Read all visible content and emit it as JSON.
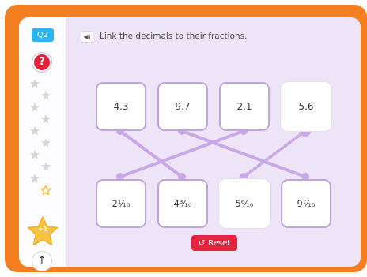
{
  "question": {
    "badge": "Q2",
    "instruction": "Link the decimals to their fractions."
  },
  "sidebar": {
    "help_label": "?",
    "stars_total": 10,
    "stars_earned": 1,
    "star_reward": "+1",
    "scroll_label": "↑"
  },
  "decimals": [
    "4.3",
    "9.7",
    "2.1",
    "5.6"
  ],
  "fractions": [
    "2¹⁄₁₀",
    "4³⁄₁₀",
    "5⁶⁄₁₀",
    "9⁷⁄₁₀"
  ],
  "links": [
    {
      "decimal": "4.3",
      "fraction": "4³⁄₁₀",
      "status": "linked"
    },
    {
      "decimal": "9.7",
      "fraction": "9⁷⁄₁₀",
      "status": "linked"
    },
    {
      "decimal": "2.1",
      "fraction": "2¹⁄₁₀",
      "status": "linked"
    },
    {
      "decimal": "5.6",
      "fraction": "5⁶⁄₁₀",
      "status": "pending"
    }
  ],
  "reset_label": "Reset",
  "colors": {
    "frame": "#f47f20",
    "panel": "#ede5f7",
    "link": "#c8a8e6",
    "accent_red": "#e5233d",
    "badge_blue": "#29b6f0",
    "star_gold": "#f6c343",
    "star_grey": "#d7d7d7"
  }
}
